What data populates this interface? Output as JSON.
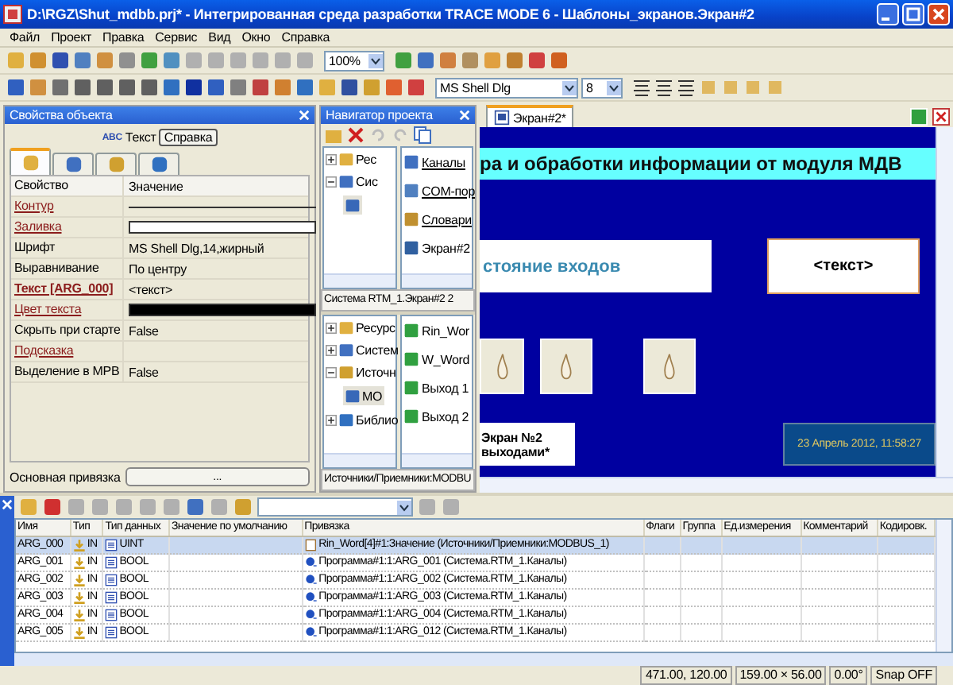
{
  "window": {
    "title": "D:\\RGZ\\Shut_mdbb.prj* - Интегрированная среда разработки TRACE MODE 6 - Шаблоны_экранов.Экран#2"
  },
  "menu": [
    "Файл",
    "Проект",
    "Правка",
    "Сервис",
    "Вид",
    "Окно",
    "Справка"
  ],
  "toolbar": {
    "zoom": "100%",
    "font": "MS Shell Dlg",
    "font_size": "8"
  },
  "properties": {
    "title": "Свойства объекта",
    "object_badge": "ABC",
    "object_type": "Текст",
    "help_button": "Справка",
    "tabs": [
      {
        "selected": true
      },
      {
        "selected": false
      },
      {
        "selected": false
      },
      {
        "selected": false
      }
    ],
    "columns": [
      "Свойство",
      "Значение"
    ],
    "rows": [
      {
        "name": "Контур",
        "linked": true,
        "bold": false,
        "kind": "line"
      },
      {
        "name": "Заливка",
        "linked": true,
        "bold": false,
        "kind": "swatch",
        "color": "#ffffff"
      },
      {
        "name": "Шрифт",
        "linked": false,
        "bold": false,
        "kind": "text",
        "value": "MS Shell Dlg,14,жирный"
      },
      {
        "name": "Выравнивание",
        "linked": false,
        "bold": false,
        "kind": "text",
        "value": "По центру"
      },
      {
        "name": "Текст [ARG_000]",
        "linked": true,
        "bold": true,
        "kind": "text",
        "value": "<текст>"
      },
      {
        "name": "Цвет текста",
        "linked": true,
        "bold": false,
        "kind": "swatch",
        "color": "#000000"
      },
      {
        "name": "Скрыть при старте",
        "linked": false,
        "bold": false,
        "kind": "text",
        "value": "False"
      },
      {
        "name": "Подсказка",
        "linked": true,
        "bold": false,
        "kind": "empty"
      },
      {
        "name": "Выделение в МРВ",
        "linked": false,
        "bold": false,
        "kind": "text",
        "value": "False"
      }
    ],
    "binding_label": "Основная привязка",
    "binding_button": "..."
  },
  "navigator": {
    "title": "Навигатор проекта",
    "top": {
      "tree": [
        {
          "label": "Рес",
          "expanded": false
        },
        {
          "label": "Сис",
          "expanded": true,
          "children": [
            {
              "selected": true
            }
          ]
        }
      ],
      "list": [
        {
          "label": "Каналы",
          "linked": true
        },
        {
          "label": "COM-пор",
          "linked": true
        },
        {
          "label": "Словари",
          "linked": true
        },
        {
          "label": "Экран#2",
          "linked": false
        }
      ]
    },
    "path": "Система RTM_1.Экран#2 2",
    "bottom": {
      "tree": [
        {
          "label": "Ресурс",
          "expanded": false
        },
        {
          "label": "Систем",
          "expanded": false
        },
        {
          "label": "Источн",
          "expanded": true,
          "children": [
            {
              "label": "MO",
              "selected": true
            }
          ]
        },
        {
          "label": "Библио",
          "expanded": false
        }
      ],
      "list": [
        {
          "label": "Rin_Wor",
          "linked": false
        },
        {
          "label": "W_Word",
          "linked": false
        },
        {
          "label": "Выход 1",
          "linked": false
        },
        {
          "label": "Выход 2",
          "linked": false
        }
      ]
    },
    "status": "Источники/Приемники:MODBU"
  },
  "editor": {
    "tab": "Экран#2*",
    "title_strip": "ра и обработки информации от модуля МДВ",
    "label_box": "стояние входов",
    "text_box": "<текст>",
    "caption_lines": [
      "Экран №2",
      "выходами*"
    ],
    "datetime": "23 Апрель 2012, 11:58:27"
  },
  "arguments": {
    "columns": [
      "Имя",
      "Тип",
      "Тип данных",
      "Значение по умолчанию",
      "Привязка",
      "Флаги",
      "Группа",
      "Ед.измерения",
      "Комментарий",
      "Кодировк."
    ],
    "rows": [
      {
        "name": "ARG_000",
        "type": "IN",
        "data_type": "UINT",
        "binding": "Rin_Word[4]#1:Значение (Источники/Приемники:MODBUS_1)",
        "kind": "source",
        "selected": true
      },
      {
        "name": "ARG_001",
        "type": "IN",
        "data_type": "BOOL",
        "binding": "Программа#1:1:ARG_001 (Система.RTM_1.Каналы)",
        "kind": "program",
        "selected": false
      },
      {
        "name": "ARG_002",
        "type": "IN",
        "data_type": "BOOL",
        "binding": "Программа#1:1:ARG_002 (Система.RTM_1.Каналы)",
        "kind": "program",
        "selected": false
      },
      {
        "name": "ARG_003",
        "type": "IN",
        "data_type": "BOOL",
        "binding": "Программа#1:1:ARG_003 (Система.RTM_1.Каналы)",
        "kind": "program",
        "selected": false
      },
      {
        "name": "ARG_004",
        "type": "IN",
        "data_type": "BOOL",
        "binding": "Программа#1:1:ARG_004 (Система.RTM_1.Каналы)",
        "kind": "program",
        "selected": false
      },
      {
        "name": "ARG_005",
        "type": "IN",
        "data_type": "BOOL",
        "binding": "Программа#1:1:ARG_012 (Система.RTM_1.Каналы)",
        "kind": "program",
        "selected": false
      }
    ]
  },
  "status_bar": [
    "471.00, 120.00",
    "159.00 × 56.00",
    "0.00°",
    "Snap OFF"
  ]
}
